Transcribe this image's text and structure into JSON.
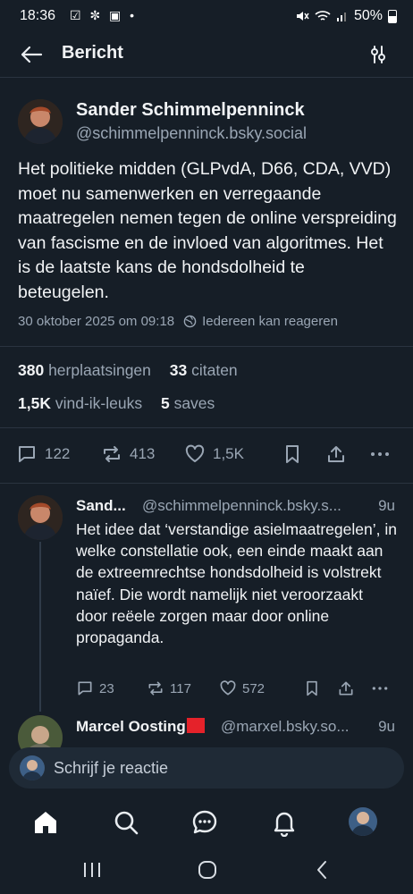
{
  "status_bar": {
    "time": "18:36",
    "left_icons": "☑ ✼ ▣ •",
    "battery": "50%"
  },
  "header": {
    "title": "Bericht"
  },
  "post": {
    "author_name": "Sander Schimmelpenninck",
    "author_handle": "@schimmelpenninck.bsky.social",
    "text": "Het politieke midden (GLPvdA, D66, CDA, VVD) moet nu samenwerken en verregaande maatregelen nemen tegen de online verspreiding van fascisme en de invloed van algoritmes. Het is de laatste kans de hondsdolheid te beteugelen.",
    "timestamp": "30 oktober 2025 om 09:18",
    "reply_setting": "Iedereen kan reageren",
    "reposts_count": "380",
    "reposts_label": "herplaatsingen",
    "quotes_count": "33",
    "quotes_label": "citaten",
    "likes_count": "1,5K",
    "likes_label": "vind-ik-leuks",
    "saves_count": "5",
    "saves_label": "saves",
    "actions": {
      "replies": "122",
      "reposts": "413",
      "likes": "1,5K"
    }
  },
  "replies": [
    {
      "author_name": "Sand...",
      "author_handle": "@schimmelpenninck.bsky.s...",
      "time": "9u",
      "text": "Het idee dat ‘verstandige asielmaatregelen’, in welke constellatie ook, een einde maakt aan de extreemrechtse hondsdolheid is volstrekt naïef. Die wordt namelijk niet veroorzaakt door reëele zorgen maar door online propaganda.",
      "replies": "23",
      "reposts": "117",
      "likes": "572"
    },
    {
      "author_name": "Marcel Oosting",
      "author_handle": "@marxel.bsky.so...",
      "time": "9u"
    }
  ],
  "composer": {
    "placeholder": "Schrijf je reactie"
  },
  "icons": {
    "back": "arrow-left-icon",
    "filter": "sliders-icon",
    "reply_setting": "globe-icon",
    "reply": "speech-bubble-icon",
    "repost": "repost-icon",
    "like": "heart-icon",
    "bookmark": "bookmark-icon",
    "share": "share-icon",
    "more": "ellipsis-icon",
    "nav": [
      "home-icon",
      "search-icon",
      "chat-icon",
      "bell-icon",
      "profile-avatar"
    ]
  },
  "colors": {
    "background": "#161e27",
    "text": "#f1f3f5",
    "muted": "#9aa6b4",
    "flag": "#e5222a"
  }
}
